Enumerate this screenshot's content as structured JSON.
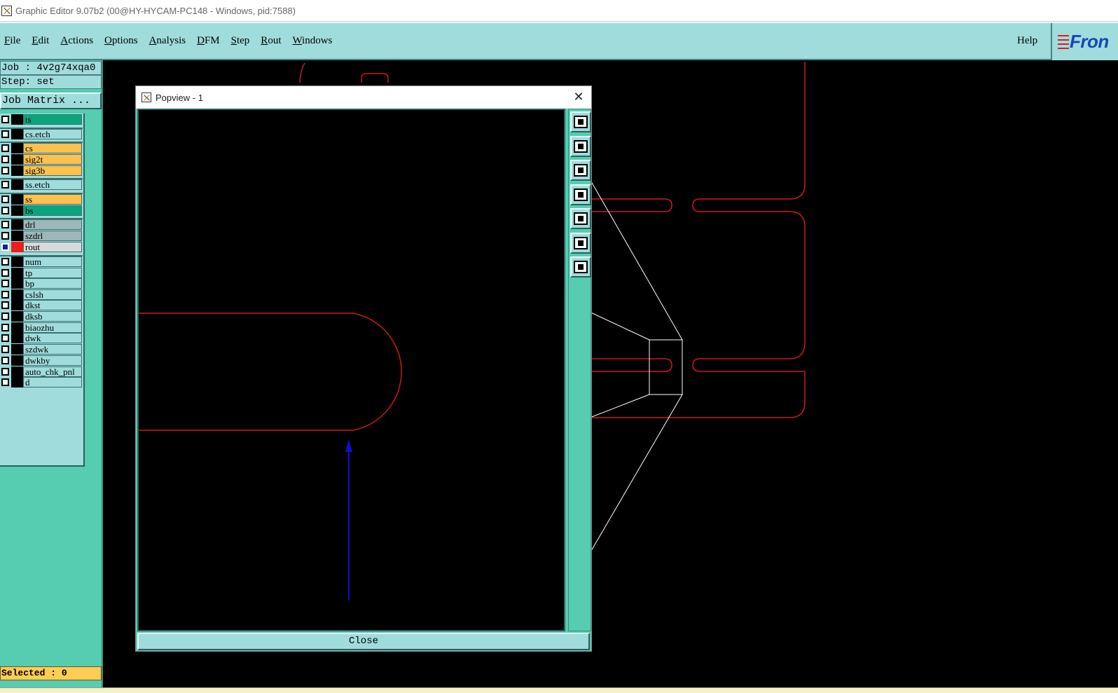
{
  "window": {
    "title": "Graphic Editor 9.07b2 (00@HY-HYCAM-PC148 - Windows, pid:7588)"
  },
  "menubar": {
    "items": [
      "File",
      "Edit",
      "Actions",
      "Options",
      "Analysis",
      "DFM",
      "Step",
      "Rout",
      "Windows"
    ],
    "help": "Help",
    "logo": "Fron"
  },
  "leftpanel": {
    "job": "Job : 4v2g74xqa0",
    "step": "Step: set",
    "job_matrix": "Job Matrix ...",
    "selected": "Selected : 0",
    "layers": [
      {
        "name": "ts",
        "color": "#0aa57d"
      },
      {
        "name": "cs.etch",
        "color": "#a0dcdc"
      },
      {
        "name": "cs",
        "color": "#ffc04d"
      },
      {
        "name": "sig2t",
        "color": "#ffc04d"
      },
      {
        "name": "sig3b",
        "color": "#ffc04d"
      },
      {
        "name": "ss.etch",
        "color": "#a0dcdc"
      },
      {
        "name": "ss",
        "color": "#ffc04d"
      },
      {
        "name": "bs",
        "color": "#0aa57d"
      },
      {
        "name": "drl",
        "color": "#9db7bb"
      },
      {
        "name": "szdrl",
        "color": "#9db7bb"
      },
      {
        "name": "rout",
        "color": "#d9d9d9"
      },
      {
        "name": "num",
        "color": "#a0dcdc"
      },
      {
        "name": "tp",
        "color": "#a0dcdc"
      },
      {
        "name": "bp",
        "color": "#a0dcdc"
      },
      {
        "name": "cslsh",
        "color": "#a0dcdc"
      },
      {
        "name": "dkst",
        "color": "#a0dcdc"
      },
      {
        "name": "dksb",
        "color": "#a0dcdc"
      },
      {
        "name": "biaozhu",
        "color": "#a0dcdc"
      },
      {
        "name": "dwk",
        "color": "#a0dcdc"
      },
      {
        "name": "szdwk",
        "color": "#a0dcdc"
      },
      {
        "name": "dwkby",
        "color": "#a0dcdc"
      },
      {
        "name": "auto_chk_pnl",
        "color": "#a0dcdc"
      },
      {
        "name": "d",
        "color": "#a0dcdc"
      }
    ]
  },
  "popview": {
    "title": "Popview - 1",
    "close_label": "Close",
    "tools": [
      "zoom-window-icon",
      "pan-up-icon",
      "pan-down-icon",
      "pan-left-icon",
      "pan-right-icon",
      "zoom-fit-icon",
      "zoom-center-icon"
    ]
  },
  "colors": {
    "panel": "#a0dcdc",
    "panel_dark": "#56ccb0",
    "rout_line": "#cc1a1a",
    "arrow": "#1010cc",
    "selection": "#ffffff"
  }
}
